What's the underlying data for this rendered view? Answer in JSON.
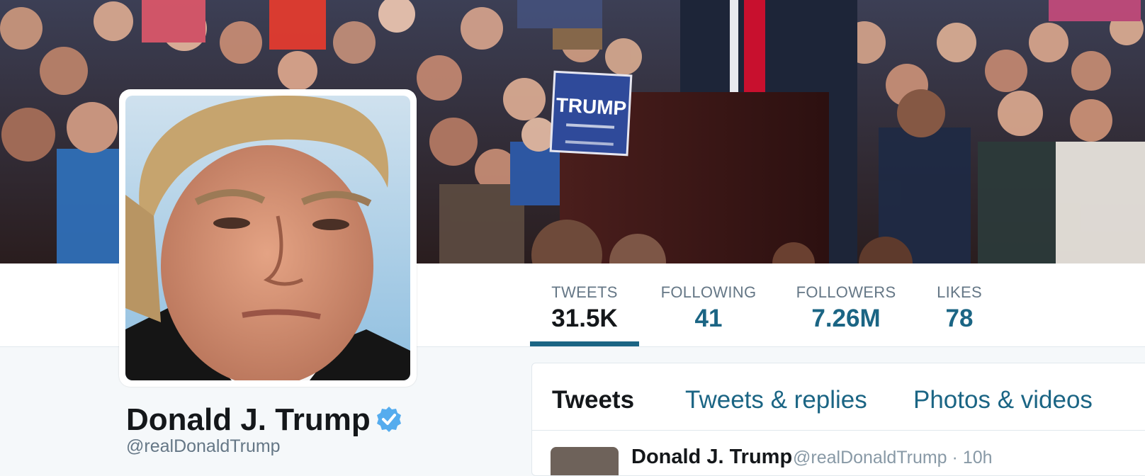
{
  "banner": {
    "sign_text": "TRUMP"
  },
  "stats": [
    {
      "label": "TWEETS",
      "value": "31.5K",
      "active": true
    },
    {
      "label": "FOLLOWING",
      "value": "41",
      "active": false
    },
    {
      "label": "FOLLOWERS",
      "value": "7.26M",
      "active": false
    },
    {
      "label": "LIKES",
      "value": "78",
      "active": false
    }
  ],
  "profile": {
    "name": "Donald J. Trump",
    "handle": "@realDonaldTrump",
    "verified": true
  },
  "timeline": {
    "tabs": [
      "Tweets",
      "Tweets & replies",
      "Photos & videos"
    ],
    "tweet": {
      "name": "Donald J. Trump",
      "handle": "@realDonaldTrump",
      "time": "10h"
    }
  },
  "colors": {
    "accent": "#1b6584",
    "verified": "#55acee",
    "text": "#14171a",
    "muted": "#657786"
  }
}
